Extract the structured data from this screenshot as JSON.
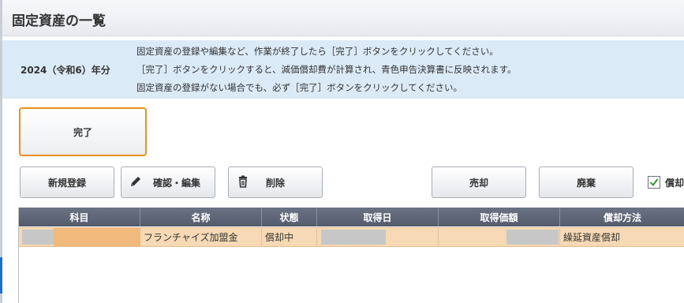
{
  "page_title": "固定資産の一覧",
  "banner": {
    "year_label": "2024（令和6）年分",
    "messages": [
      "固定資産の登録や編集など、作業が終了したら［完了］ボタンをクリックしてください。",
      "［完了］ボタンをクリックすると、減価償却費が計算され、青色申告決算書に反映されます。",
      "固定資産の登録がない場合でも、必ず［完了］ボタンをクリックしてください。"
    ]
  },
  "buttons": {
    "done": "完了",
    "new_register": "新規登録",
    "confirm_edit": "確認・編集",
    "delete": "削除",
    "sell": "売却",
    "dispose": "廃棄"
  },
  "checkbox": {
    "label": "償却",
    "checked": true
  },
  "table": {
    "columns": [
      "科目",
      "名称",
      "状態",
      "取得日",
      "取得価額",
      "償却方法"
    ],
    "rows": [
      {
        "subject": "",
        "name": "フランチャイズ加盟金",
        "status": "償却中",
        "acquired_date": "",
        "acquired_price": "",
        "method": "繰延資産償却",
        "selected": true
      }
    ]
  },
  "colors": {
    "accent_border": "#e8901e",
    "banner_bg": "#dbeaf7",
    "header_bg": "#5f6778",
    "selected_row": "#f7d9b5"
  },
  "icons": {
    "edit": "pencil-icon",
    "delete": "trash-icon",
    "checkbox": "check-icon"
  }
}
